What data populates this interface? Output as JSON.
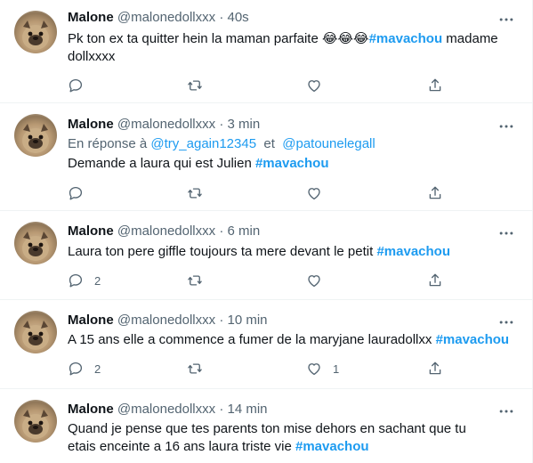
{
  "tweets": [
    {
      "name": "Malone",
      "handle": "@malonedollxxx",
      "separator": "·",
      "time": "40s",
      "reply_prefix": "",
      "reply_to_1": "",
      "reply_joiner": "",
      "reply_to_2": "",
      "text_before": "Pk ton ex ta quitter hein la maman parfaite 😂😂😂",
      "hashtag": "#mavachou",
      "text_after": " madame dollxxxx",
      "reply_count": "",
      "retweet_count": "",
      "like_count": ""
    },
    {
      "name": "Malone",
      "handle": "@malonedollxxx",
      "separator": "·",
      "time": "3 min",
      "reply_prefix": "En réponse à ",
      "reply_to_1": "@try_again12345",
      "reply_joiner": "  et  ",
      "reply_to_2": "@patounelegall",
      "text_before": "Demande a laura qui est Julien ",
      "hashtag": "#mavachou",
      "text_after": "",
      "reply_count": "",
      "retweet_count": "",
      "like_count": ""
    },
    {
      "name": "Malone",
      "handle": "@malonedollxxx",
      "separator": "·",
      "time": "6 min",
      "reply_prefix": "",
      "reply_to_1": "",
      "reply_joiner": "",
      "reply_to_2": "",
      "text_before": "Laura ton pere giffle toujours ta mere devant le petit ",
      "hashtag": "#mavachou",
      "text_after": "",
      "reply_count": "2",
      "retweet_count": "",
      "like_count": ""
    },
    {
      "name": "Malone",
      "handle": "@malonedollxxx",
      "separator": "·",
      "time": "10 min",
      "reply_prefix": "",
      "reply_to_1": "",
      "reply_joiner": "",
      "reply_to_2": "",
      "text_before": "A 15 ans elle a commence a fumer de la maryjane lauradollxx ",
      "hashtag": "#mavachou",
      "text_after": "",
      "reply_count": "2",
      "retweet_count": "",
      "like_count": "1"
    },
    {
      "name": "Malone",
      "handle": "@malonedollxxx",
      "separator": "·",
      "time": "14 min",
      "reply_prefix": "",
      "reply_to_1": "",
      "reply_joiner": "",
      "reply_to_2": "",
      "text_before": "Quand je pense que tes parents ton mise dehors en sachant que tu etais enceinte a 16 ans laura triste vie ",
      "hashtag": "#mavachou",
      "text_after": "",
      "reply_count": "",
      "retweet_count": "",
      "like_count": ""
    }
  ],
  "icons": {
    "avatar": "pug-avatar",
    "more": "more-dots-icon",
    "reply": "reply-icon",
    "retweet": "retweet-icon",
    "like": "heart-icon",
    "share": "share-icon"
  },
  "colors": {
    "hashtag": "#1d9bf0",
    "secondary_text": "#536471",
    "divider": "#eff3f4"
  }
}
